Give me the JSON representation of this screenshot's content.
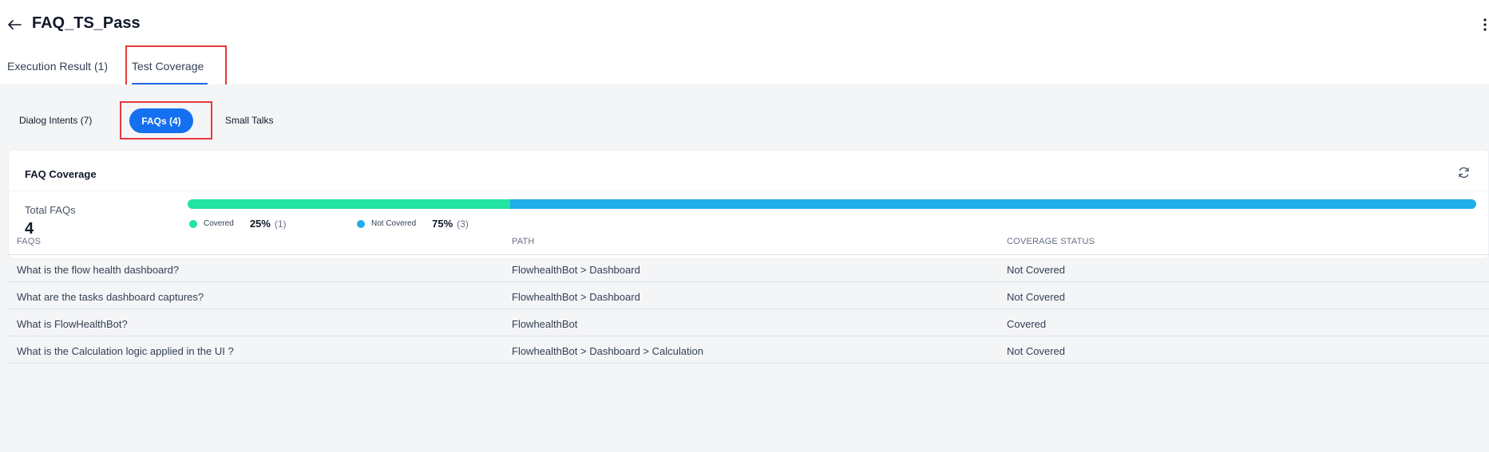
{
  "header": {
    "title": "FAQ_TS_Pass"
  },
  "tabs": [
    {
      "label": "Execution Result (1)",
      "active": false
    },
    {
      "label": "Test Coverage",
      "active": true
    }
  ],
  "subtabs": [
    {
      "label": "Dialog Intents (7)",
      "active": false
    },
    {
      "label": "FAQs (4)",
      "active": true
    },
    {
      "label": "Small Talks",
      "active": false
    }
  ],
  "coverage": {
    "title": "FAQ Coverage",
    "total_label": "Total FAQs",
    "total_value": "4",
    "covered": {
      "label": "Covered",
      "percent": "25%",
      "count": "(1)",
      "fraction": 0.25,
      "color": "#22e3a2"
    },
    "not_covered": {
      "label": "Not Covered",
      "percent": "75%",
      "count": "(3)",
      "fraction": 0.75,
      "color": "#1faee9"
    }
  },
  "table": {
    "headers": [
      "FAQS",
      "PATH",
      "COVERAGE STATUS"
    ],
    "rows": [
      [
        "What is the flow health dashboard?",
        "FlowhealthBot > Dashboard",
        "Not Covered"
      ],
      [
        "What are the tasks dashboard captures?",
        "FlowhealthBot > Dashboard",
        "Not Covered"
      ],
      [
        "What is FlowHealthBot?",
        "FlowhealthBot",
        "Covered"
      ],
      [
        "What is the Calculation logic applied in the UI ?",
        "FlowhealthBot > Dashboard > Calculation",
        "Not Covered"
      ]
    ]
  },
  "colors": {
    "accent": "#1570ef",
    "tab_underline": "#2563eb",
    "highlight_box": "#e5393b"
  }
}
